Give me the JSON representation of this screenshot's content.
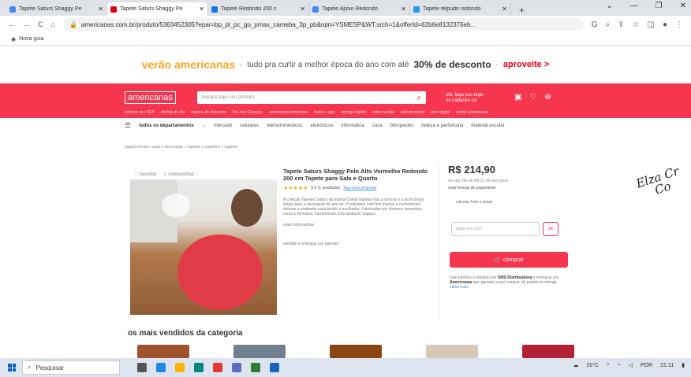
{
  "browser": {
    "tabs": [
      {
        "label": "Tapete Saturs Shaggy Pe",
        "favicon_color": "#4285f4",
        "active": false
      },
      {
        "label": "Tapete Saturs Shaggy Pe",
        "favicon_color": "#e60014",
        "active": true
      },
      {
        "label": "Tapete Redondo 200 c",
        "favicon_color": "#1a73e8",
        "active": false
      },
      {
        "label": "Tapete Apoio Redondo",
        "favicon_color": "#4285f4",
        "active": false
      },
      {
        "label": "Tapete felpudo redondo",
        "favicon_color": "#2196f3",
        "active": false
      }
    ],
    "new_tab": "+",
    "window_controls": [
      "⌄",
      "—",
      "❐",
      "✕"
    ],
    "url": "americanas.com.br/produto/5363452305?epar=bp_pl_pc_go_pmax_cameba_3p_pb&opn=YSMESP&WT.srch=1&offerId=62b6e8132376eb..."
  },
  "bookmarks": {
    "new_tab_label": "Nova guia"
  },
  "promo": {
    "brand": "verão americanas",
    "separator": "·",
    "text": "tudo pra curtir a melhor época do ano com até",
    "highlight": "30% de desconto",
    "cta": "aproveite >"
  },
  "header": {
    "logo": "americanas",
    "search_placeholder": "busque aqui seu produto",
    "login_line1": "olá, faça seu login",
    "login_line2": "ou cadastre-se",
    "sublinks": [
      "informe seu CEP",
      "ofertas do dia",
      "cupons de desconto",
      "Dia das Crianças",
      "americanas empresas",
      "baixe o app",
      "entrega rápida",
      "retire na loja",
      "vale-presente",
      "ame digital",
      "cartão americanas"
    ]
  },
  "nav": {
    "all_departments": "todos os departamentos",
    "categories": [
      "mercado",
      "celulares",
      "eletrodomésticos",
      "eletrônicos",
      "informática",
      "casa",
      "brinquedos",
      "beleza e perfumaria",
      "material escolar"
    ]
  },
  "breadcrumb": "página inicial > casa e decoração > tapetes e carpetes > tapetes",
  "product": {
    "actions": [
      "♡ favoritar",
      "⇪ compartilhar"
    ],
    "title": "Tapete Saturs Shaggy Pelo Alto Vermelho Redondo 200 cm Tapete para Sala e Quarto",
    "stars": "★★★★★",
    "rating_text": "5.0 (1 avaliação)",
    "rating_link": "faça uma pergunta",
    "description": "A coleção Tapetes Saturs da marca Cristal Tapetes traz a ternura e o aconchego ideais para a decoração do seu lar. Produzidos com fios macios e confortáveis, deixam o ambiente mais bonito e acolhedor. Fabricados em diversos tamanhos, cores e formatos, harmonizam com qualquer espaço.",
    "more_link": "mais informações",
    "sold_by": "vendido e entregue por parceiro"
  },
  "purchase": {
    "price": "R$ 214,90",
    "installments": "em até 10x de R$ 21,49 sem juros",
    "payment_link": "mais formas de pagamento",
    "shipping_label": "calcular frete e prazo",
    "cep_placeholder": "digite seu CEP",
    "ok_label": "ok",
    "buy_label": "comprar",
    "seller_prefix": "este produto é vendido por",
    "seller_name": "SMS Distribuidora",
    "seller_middle": "e entregue por",
    "seller_delivery": "Americanas",
    "seller_suffix": "que garante a sua compra, do pedido à entrega.",
    "seller_link": "saiba mais"
  },
  "section_title": "os mais vendidos da categoria",
  "thumbs_colors": [
    "#a0522d",
    "#708090",
    "#8b4513",
    "#d8c8b8",
    "#b22234"
  ],
  "watermark": {
    "line1": "Elza Cr",
    "line2": "Co"
  },
  "taskbar": {
    "search": "Pesquisar",
    "app_colors": [
      "#555",
      "#1e88e5",
      "#ffb300",
      "#00897b",
      "#e53935",
      "#5c6bc0",
      "#2e7d32",
      "#1565c0"
    ],
    "weather": "26°C",
    "lang": "POR",
    "time": "21:11"
  },
  "colors": {
    "brand_red": "#f5364e",
    "brand_yellow": "#f5a623"
  }
}
